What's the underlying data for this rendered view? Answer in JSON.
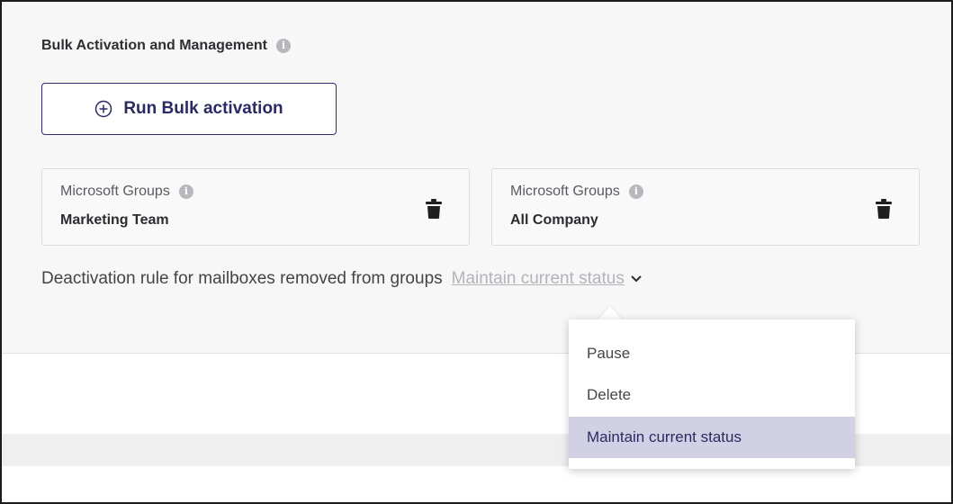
{
  "section": {
    "title": "Bulk Activation and Management",
    "info_icon": "info-icon"
  },
  "bulk_button": {
    "label": "Run Bulk activation",
    "icon": "plus-circle-icon",
    "color": "#2f2e6f"
  },
  "groups": [
    {
      "label": "Microsoft Groups",
      "value": "Marketing Team",
      "icon": "trash-icon"
    },
    {
      "label": "Microsoft Groups",
      "value": "All Company",
      "icon": "trash-icon"
    }
  ],
  "deactivation_rule": {
    "label": "Deactivation rule for mailboxes removed from groups",
    "selected": "Maintain current status",
    "icon": "chevron-down-icon"
  },
  "dropdown": {
    "options": [
      "Pause",
      "Delete",
      "Maintain current status"
    ],
    "highlight_color": "#d1d0e4"
  }
}
